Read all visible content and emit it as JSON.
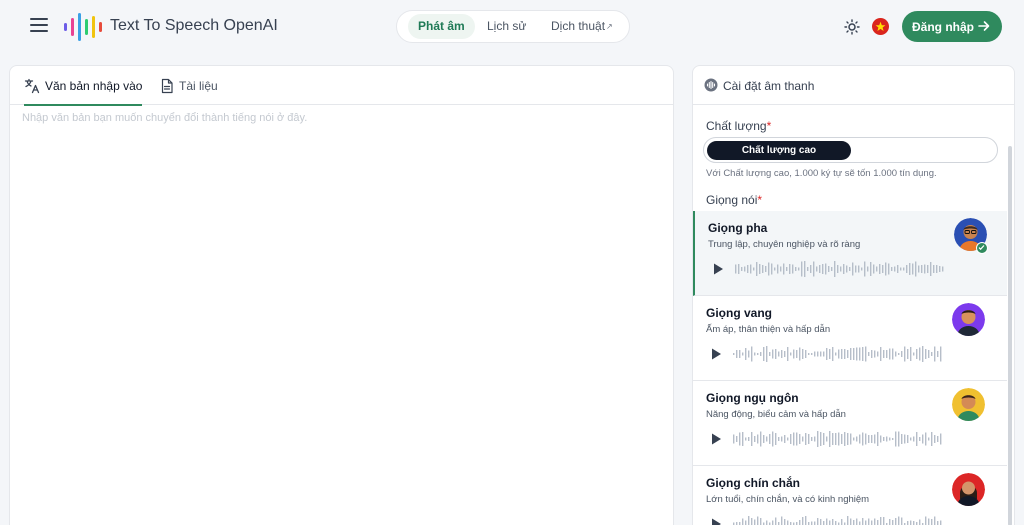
{
  "header": {
    "app_title": "Text To Speech OpenAI",
    "nav": [
      {
        "label": "Phát âm",
        "active": true
      },
      {
        "label": "Lịch sử",
        "active": false
      },
      {
        "label": "Dịch thuật",
        "active": false,
        "external": true
      }
    ],
    "login_label": "Đăng nhập",
    "colors": {
      "accent": "#2f8a5e",
      "logo_bars": [
        "#6c5ce7",
        "#e84393",
        "#3aa0e6",
        "#2ecc71",
        "#f1c40f",
        "#e74c3c"
      ]
    }
  },
  "editor": {
    "tabs": [
      {
        "label": "Văn bản nhập vào",
        "icon": "translate-icon",
        "active": true
      },
      {
        "label": "Tài liệu",
        "icon": "document-icon",
        "active": false
      }
    ],
    "placeholder": "Nhập văn bản bạn muốn chuyển đổi thành tiếng nói ở đây."
  },
  "settings": {
    "title": "Cài đặt âm thanh",
    "quality_label": "Chất lượng",
    "quality_selected": "Chất lượng cao",
    "quality_note": "Với Chất lượng cao, 1.000 ký tự sẽ tốn 1.000 tín dụng.",
    "voice_label": "Giọng nói",
    "voices": [
      {
        "name": "Giọng pha",
        "desc": "Trung lập, chuyên nghiệp và rõ ràng",
        "selected": true
      },
      {
        "name": "Giọng vang",
        "desc": "Ấm áp, thân thiện và hấp dẫn",
        "selected": false
      },
      {
        "name": "Giọng ngụ ngôn",
        "desc": "Năng động, biểu cảm và hấp dẫn",
        "selected": false
      },
      {
        "name": "Giọng chín chắn",
        "desc": "Lớn tuổi, chín chắn, và có kinh nghiệm",
        "selected": false
      }
    ]
  }
}
